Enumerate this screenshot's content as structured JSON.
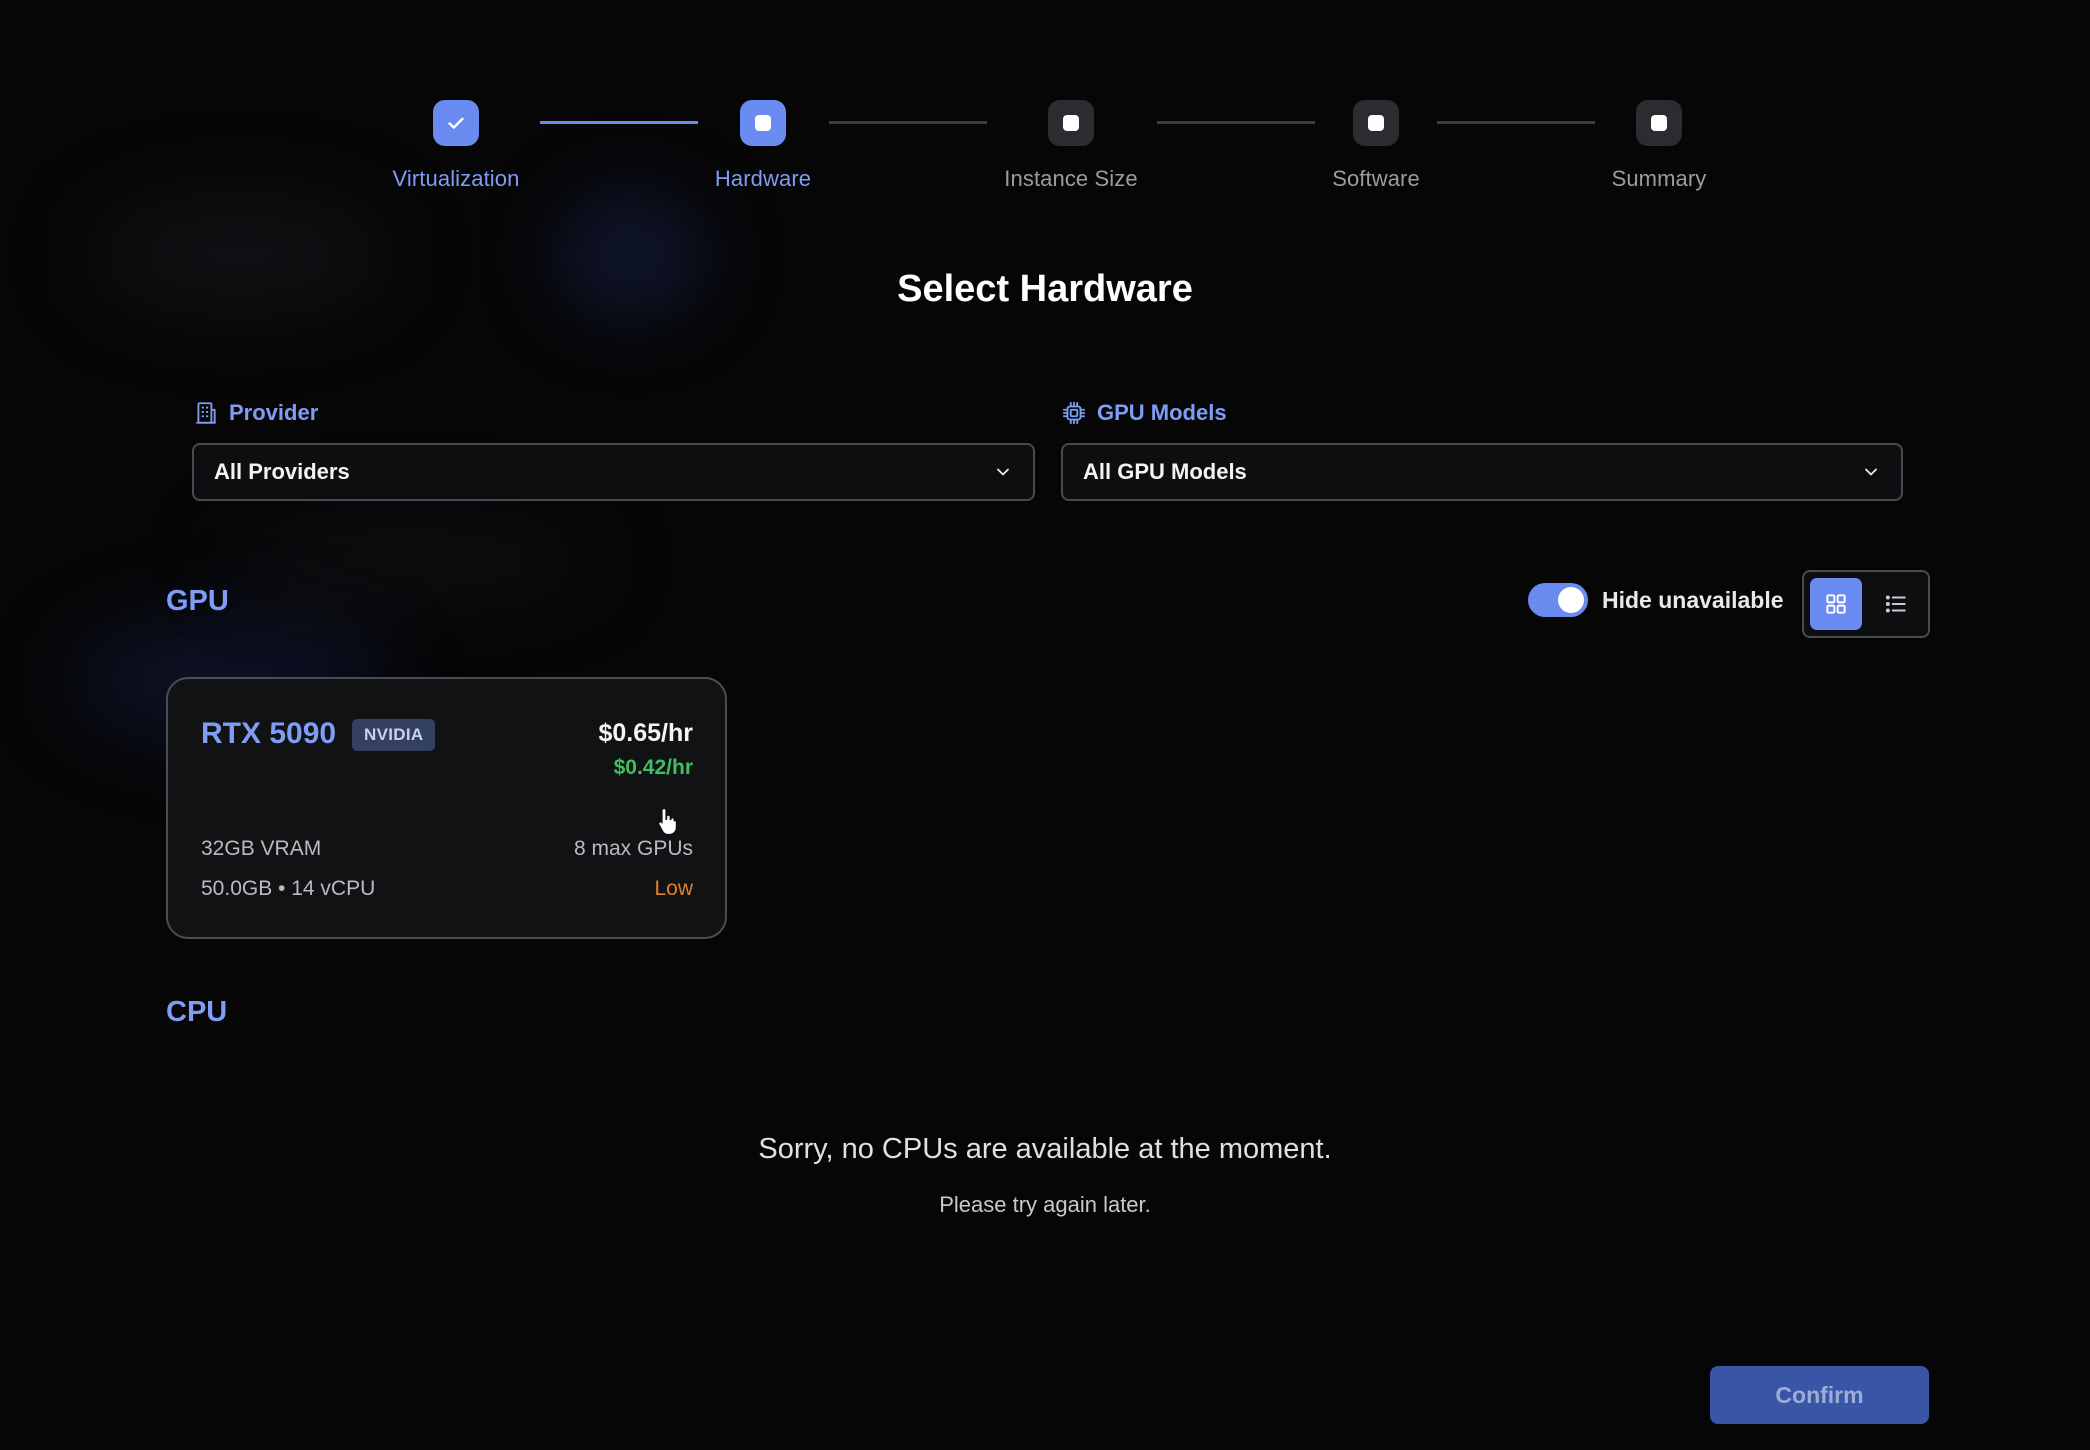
{
  "stepper": {
    "steps": [
      {
        "label": "Virtualization",
        "state": "done"
      },
      {
        "label": "Hardware",
        "state": "active"
      },
      {
        "label": "Instance Size",
        "state": "pending"
      },
      {
        "label": "Software",
        "state": "pending"
      },
      {
        "label": "Summary",
        "state": "pending"
      }
    ]
  },
  "page_title": "Select Hardware",
  "filters": {
    "provider": {
      "label": "Provider",
      "value": "All Providers",
      "icon": "building-icon"
    },
    "gpu_models": {
      "label": "GPU Models",
      "value": "All GPU Models",
      "icon": "chip-icon"
    }
  },
  "gpu_section": {
    "title": "GPU",
    "hide_unavailable": {
      "label": "Hide unavailable",
      "on": true
    },
    "view_mode": "grid",
    "cards": [
      {
        "name": "RTX 5090",
        "vendor": "NVIDIA",
        "price": "$0.65/hr",
        "discount_price": "$0.42/hr",
        "vram": "32GB VRAM",
        "max_gpus": "8 max GPUs",
        "specs": "50.0GB • 14 vCPU",
        "availability": "Low"
      }
    ]
  },
  "cpu_section": {
    "title": "CPU",
    "empty_message": "Sorry, no CPUs are available at the moment.",
    "empty_sub": "Please try again later."
  },
  "actions": {
    "confirm_label": "Confirm"
  },
  "colors": {
    "accent": "#6a8cf1",
    "background": "#060607",
    "discount": "#3fbf5f",
    "availability_low": "#e0812e"
  }
}
